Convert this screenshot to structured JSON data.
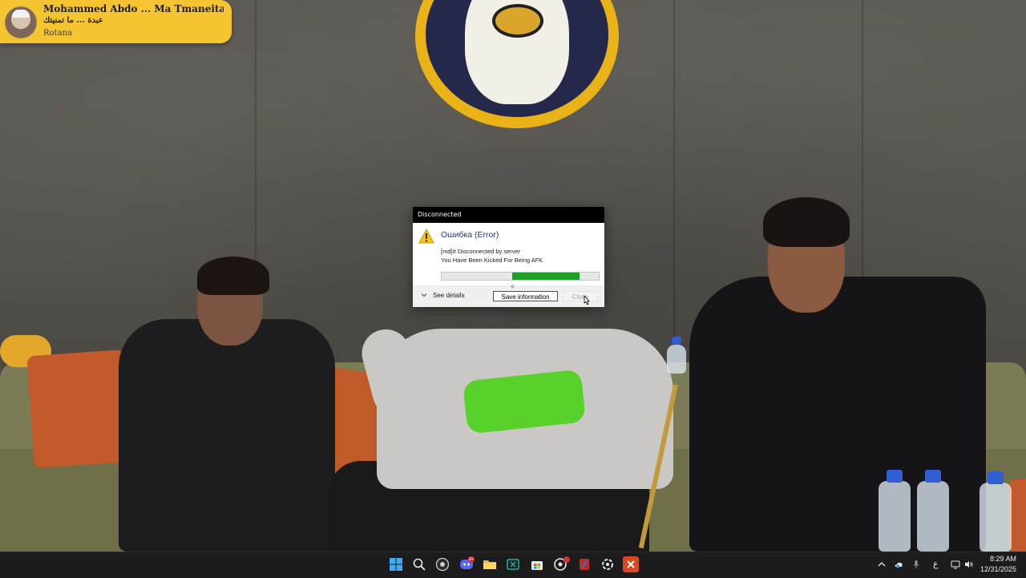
{
  "now_playing": {
    "title": "Mohammed Abdo ... Ma Tmaneitak | محمد",
    "subtitle": "عبدة ... ما تمنيتك",
    "source": "Rotana"
  },
  "dialog": {
    "window_title": "Disconnected",
    "heading": "Ошибка (Error)",
    "message_line1": "[md]# Disconnected by server",
    "message_line2": "You Have Been Kicked For Being AFK",
    "progress_note": "o",
    "progress": {
      "from": 0.45,
      "to": 0.88
    },
    "see_details_label": "See details",
    "save_button_label": "Save information",
    "close_button_label": "Close"
  },
  "taskbar": {
    "apps": [
      "start-icon",
      "search-icon",
      "obs-icon",
      "discord-icon",
      "file-explorer-icon",
      "excel-like-icon",
      "store-icon",
      "chrome-dev-icon",
      "app-red-icon",
      "app-circle-icon",
      "app-close-icon"
    ],
    "discord_badge": "9+",
    "tray": {
      "language": "ع",
      "time": "8:29 AM",
      "date": "12/31/2025"
    }
  },
  "colors": {
    "toast_bg": "#f4c531",
    "dialog_heading": "#1e3c8c",
    "progress_fill": "#1f9e2a",
    "taskbar_bg": "#1c1c1c"
  }
}
